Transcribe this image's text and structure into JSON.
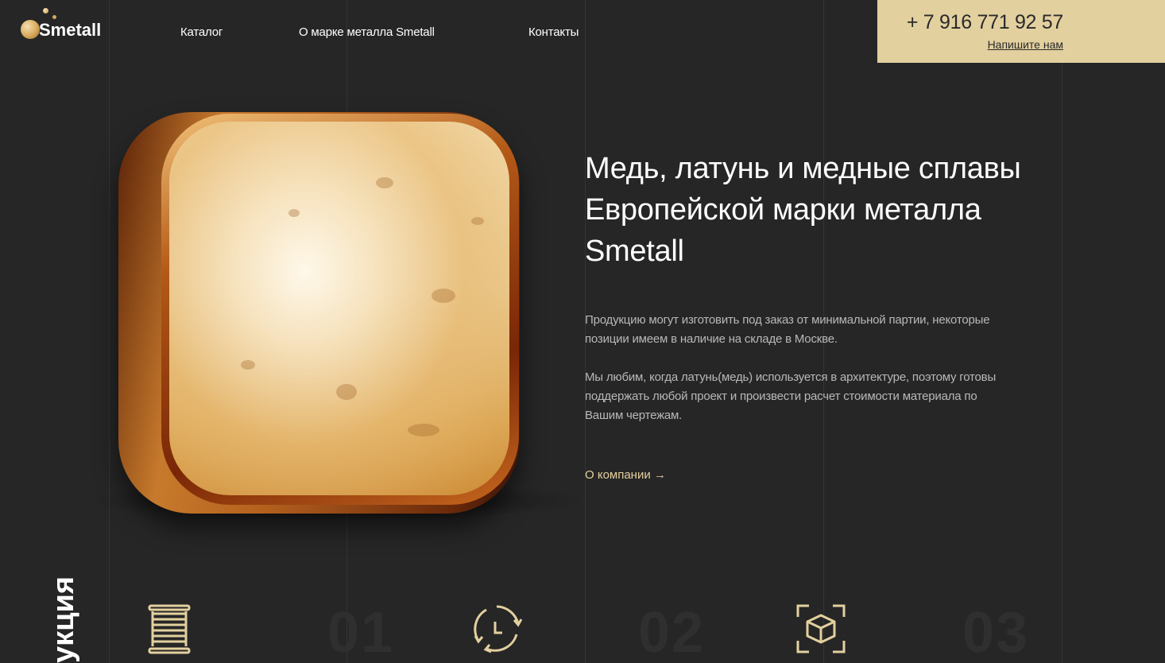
{
  "header": {
    "logo_text": "Smetall",
    "nav": [
      {
        "label": "Каталог"
      },
      {
        "label": "О марке металла Smetall"
      },
      {
        "label": "Контакты"
      }
    ],
    "contact": {
      "phone": "+ 7 916 771 92 57",
      "write_us": "Напишите нам"
    }
  },
  "hero": {
    "title": "Медь, латунь и медные сплавы Европейской марки металла Smetall",
    "paragraph_1": "Продукцию могут изготовить под заказ от минимальной партии, некоторые позиции имеем в наличие на складе в Москве.",
    "paragraph_2": "Мы любим, когда латунь(медь) используется в архитектуре, поэтому готовы поддержать любой проект и произвести расчет стоимости материала по Вашим чертежам.",
    "about_link": "О компании →"
  },
  "features": {
    "section_label": "укция",
    "items": [
      {
        "number": "01",
        "icon": "coil-icon"
      },
      {
        "number": "02",
        "icon": "clock-cycle-icon"
      },
      {
        "number": "03",
        "icon": "box-icon"
      }
    ]
  },
  "colors": {
    "background": "#262626",
    "accent": "#e3d09f",
    "text": "#ffffff",
    "muted_text": "#b8b8b8"
  }
}
